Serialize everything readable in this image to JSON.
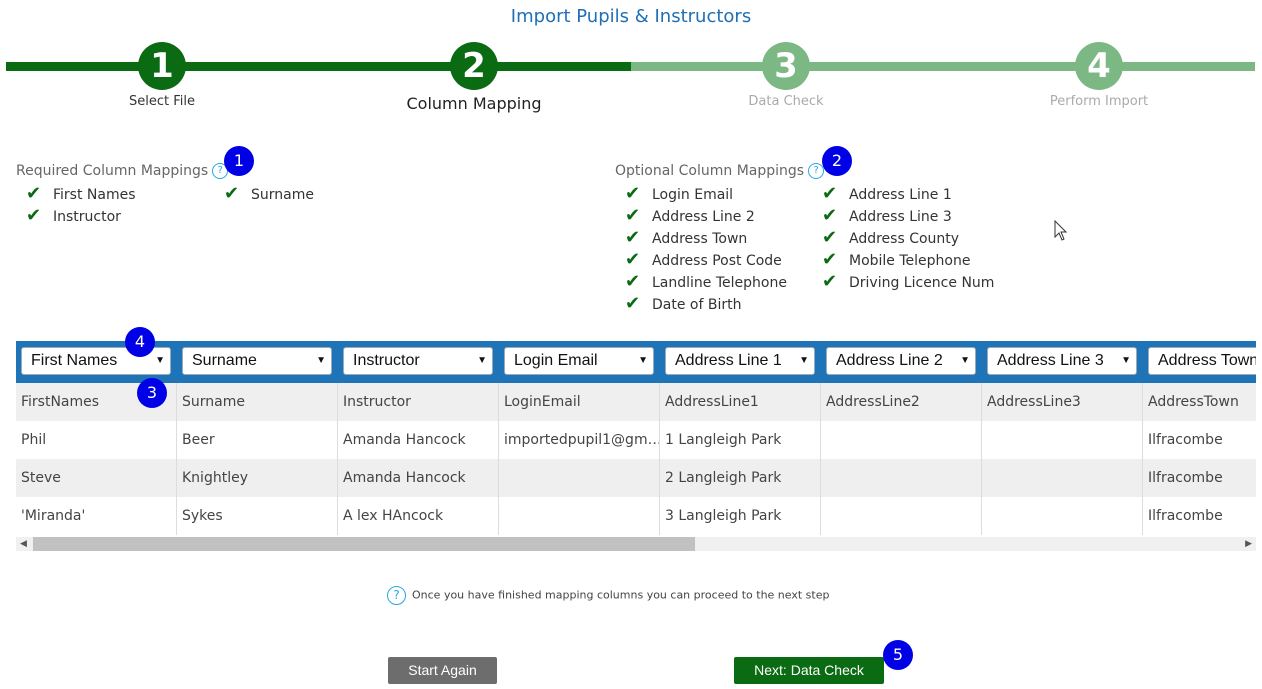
{
  "title": "Import Pupils & Instructors",
  "steps": [
    {
      "num": "1",
      "label": "Select File"
    },
    {
      "num": "2",
      "label": "Column Mapping"
    },
    {
      "num": "3",
      "label": "Data Check"
    },
    {
      "num": "4",
      "label": "Perform Import"
    }
  ],
  "badges": [
    "1",
    "2",
    "3",
    "4",
    "5"
  ],
  "required": {
    "heading": "Required Column Mappings",
    "items": [
      "First Names",
      "Surname",
      "Instructor"
    ]
  },
  "optional": {
    "heading": "Optional Column Mappings",
    "items": [
      "Login Email",
      "Address Line 1",
      "Address Line 2",
      "Address Line 3",
      "Address Town",
      "Address County",
      "Address Post Code",
      "Mobile Telephone",
      "Landline Telephone",
      "Driving Licence Num",
      "Date of Birth"
    ]
  },
  "grid": {
    "mappings": [
      "First Names",
      "Surname",
      "Instructor",
      "Login Email",
      "Address Line 1",
      "Address Line 2",
      "Address Line 3",
      "Address Town"
    ],
    "source_headers": [
      "FirstNames",
      "Surname",
      "Instructor",
      "LoginEmail",
      "AddressLine1",
      "AddressLine2",
      "AddressLine3",
      "AddressTown"
    ],
    "rows": [
      [
        "Phil",
        "Beer",
        "Amanda Hancock",
        "importedpupil1@gm…",
        "1 Langleigh Park",
        "",
        "",
        "Ilfracombe"
      ],
      [
        "Steve",
        "Knightley",
        "Amanda Hancock",
        "",
        "2 Langleigh Park",
        "",
        "",
        "Ilfracombe"
      ],
      [
        "'Miranda'",
        "Sykes",
        "A lex HAncock",
        "",
        "3 Langleigh Park",
        "",
        "",
        "Ilfracombe"
      ]
    ]
  },
  "hint": "Once you have finished mapping columns you can proceed to the next step",
  "buttons": {
    "start_again": "Start Again",
    "next": "Next: Data Check"
  }
}
